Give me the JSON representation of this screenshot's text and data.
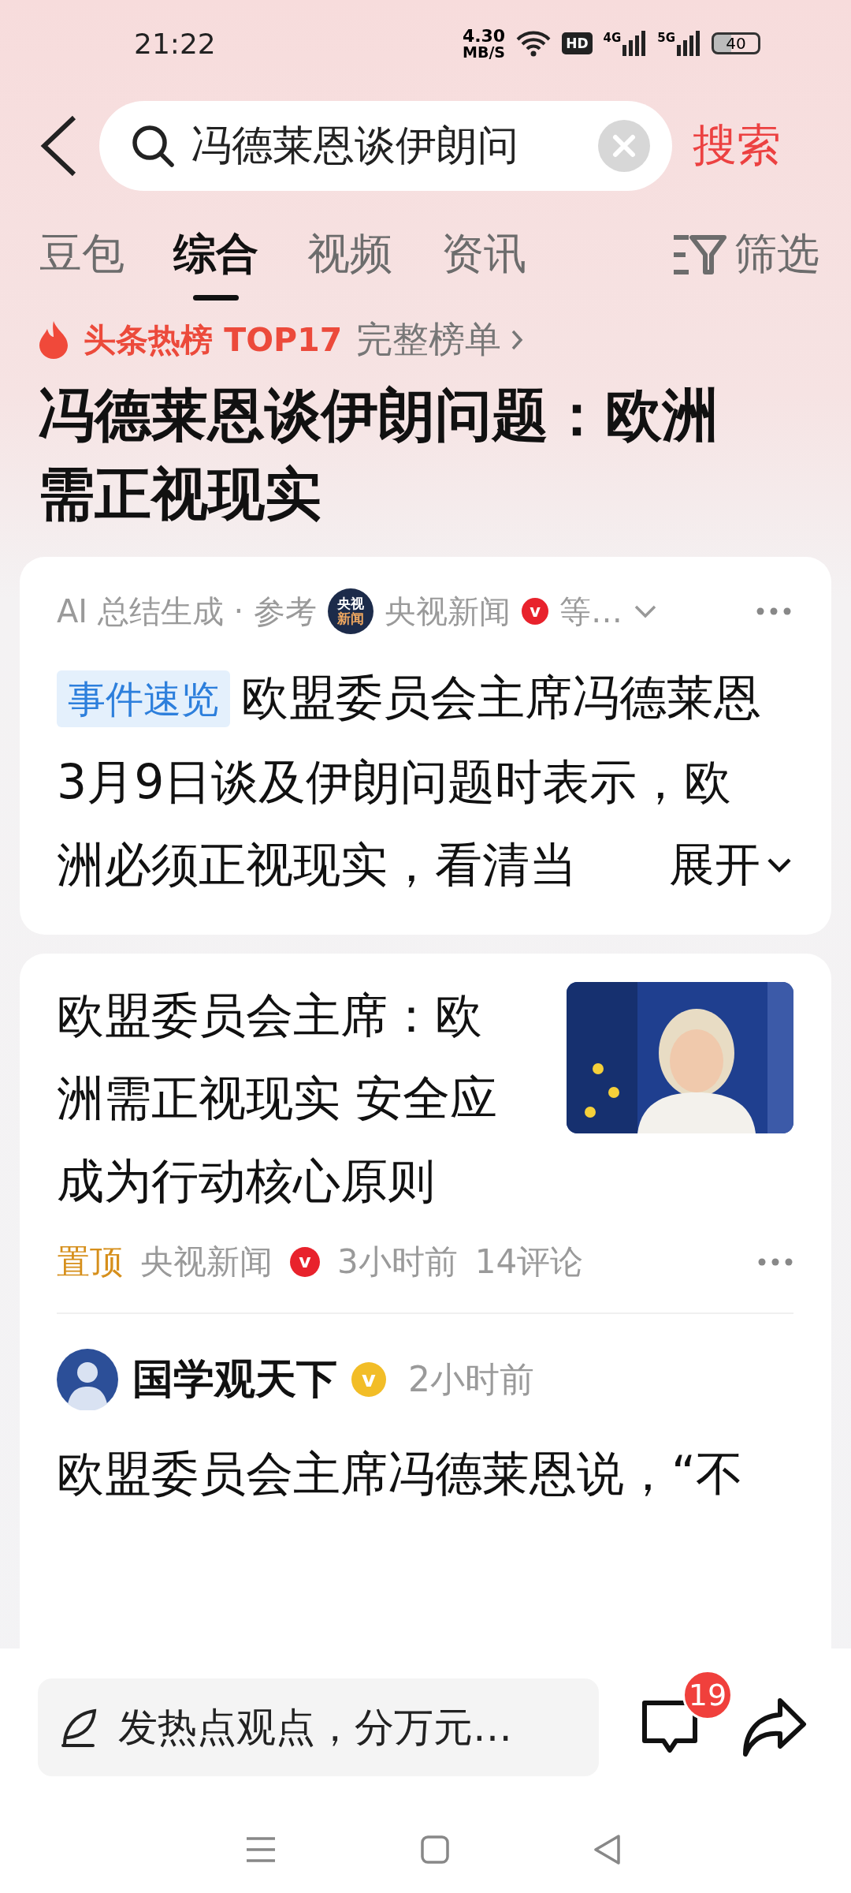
{
  "status_bar": {
    "time": "21:22",
    "net_speed": "4.30",
    "net_unit": "MB/S",
    "hd": "HD",
    "sim1": "4G",
    "sim2": "5G",
    "battery": "40"
  },
  "search": {
    "value": "冯德莱恩谈伊朗问",
    "button": "搜索"
  },
  "tabs": [
    {
      "label": "豆包",
      "selected": false
    },
    {
      "label": "综合",
      "selected": true
    },
    {
      "label": "视频",
      "selected": false
    },
    {
      "label": "资讯",
      "selected": false
    }
  ],
  "filter": {
    "label": "筛选"
  },
  "hot": {
    "label": "头条热榜 TOP17",
    "link": "完整榜单"
  },
  "topic_title": "冯德莱恩谈伊朗问题：欧洲需正视现实",
  "ai_card": {
    "meta": "AI 总结生成 · 参考",
    "source": {
      "logo_text": [
        "央视",
        "新闻"
      ],
      "name": "央视新闻",
      "verified": {
        "mark": "v",
        "color": "#e8222c"
      }
    },
    "more_sources": "等…",
    "tag": "事件速览",
    "text": "欧盟委员会主席冯德莱恩3月9日谈及伊朗问题时表示，欧洲必须正视现实，看清当",
    "expand": "展开"
  },
  "article": {
    "title": "欧盟委员会主席：欧洲需正视现实 安全应成为行动核心原则",
    "pinned": "置顶",
    "source": {
      "name": "央视新闻",
      "verified": {
        "mark": "v",
        "color": "#e8222c"
      }
    },
    "time": "3小时前",
    "comments": "14评论"
  },
  "post": {
    "author": {
      "name": "国学观天下",
      "verified": {
        "mark": "v",
        "color": "#f2bd27"
      }
    },
    "time": "2小时前",
    "text": "欧盟委员会主席冯德莱恩说，“不"
  },
  "composer": {
    "placeholder": "发热点观点，分万元…",
    "comment_count": "19"
  }
}
